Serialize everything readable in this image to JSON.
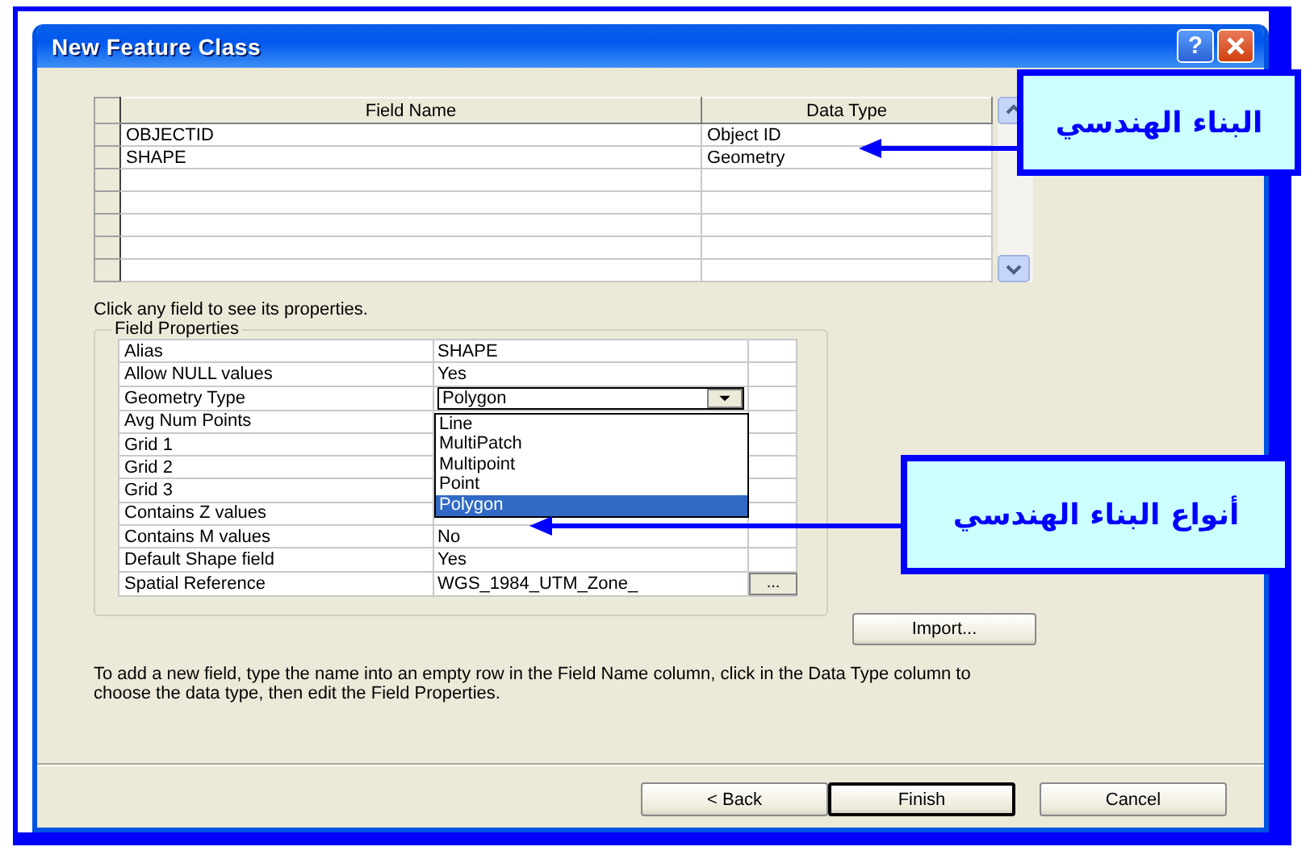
{
  "window": {
    "title": "New Feature Class",
    "help_button": "?"
  },
  "fields_table": {
    "columns": [
      "Field Name",
      "Data Type"
    ],
    "rows": [
      {
        "field_name": "OBJECTID",
        "data_type": "Object ID"
      },
      {
        "field_name": "SHAPE",
        "data_type": "Geometry"
      }
    ]
  },
  "hint": "Click any field to see its properties.",
  "field_properties": {
    "title": "Field Properties",
    "rows": [
      {
        "kind": "text",
        "label": "Alias",
        "value": "SHAPE"
      },
      {
        "kind": "text",
        "label": "Allow NULL values",
        "value": "Yes"
      },
      {
        "kind": "dropdown",
        "label": "Geometry Type",
        "value": "Polygon",
        "expanded": true
      },
      {
        "kind": "text",
        "label": "Avg Num Points"
      },
      {
        "kind": "text",
        "label": "Grid 1"
      },
      {
        "kind": "text",
        "label": "Grid 2"
      },
      {
        "kind": "text",
        "label": "Grid 3"
      },
      {
        "kind": "text",
        "label": "Contains Z values"
      },
      {
        "kind": "text",
        "label": "Contains M values",
        "value": "No"
      },
      {
        "kind": "text",
        "label": "Default Shape field",
        "value": "Yes"
      },
      {
        "kind": "browse",
        "label": "Spatial Reference",
        "value": "WGS_1984_UTM_Zone_",
        "button": "..."
      }
    ]
  },
  "dropdown_options": [
    {
      "label": "Line",
      "selected": false
    },
    {
      "label": "MultiPatch",
      "selected": false
    },
    {
      "label": "Multipoint",
      "selected": false
    },
    {
      "label": "Point",
      "selected": false
    },
    {
      "label": "Polygon",
      "selected": true
    }
  ],
  "import_button": "Import...",
  "help_text": "To add a new field, type the name into an empty row in the Field Name column, click in the Data Type column to choose the data type, then edit the Field Properties.",
  "buttons": [
    {
      "label": "< Back",
      "default": false
    },
    {
      "label": "Finish",
      "default": true
    },
    {
      "label": "Cancel",
      "default": false
    }
  ],
  "callouts": [
    {
      "kind": "top",
      "text": "البناء الهندسي"
    },
    {
      "kind": "bottom",
      "text": "أنواع البناء الهندسي"
    }
  ]
}
